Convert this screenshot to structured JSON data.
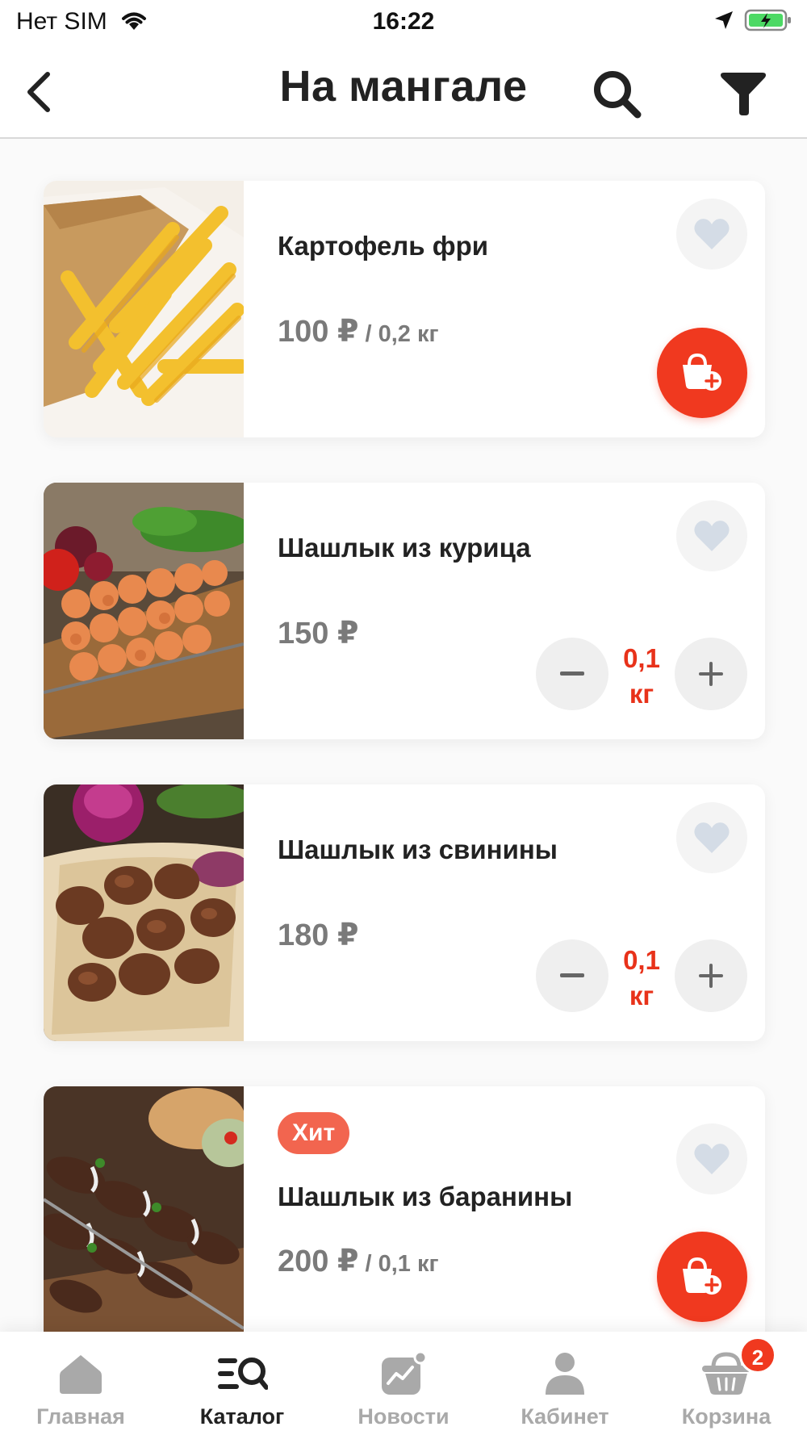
{
  "status_bar": {
    "carrier": "Нет SIM",
    "time": "16:22",
    "icons": [
      "wifi-icon",
      "location-arrow-icon",
      "battery-charging-icon"
    ]
  },
  "nav": {
    "title": "На мангале",
    "back_icon": "chevron-left-icon",
    "search_icon": "search-icon",
    "filter_icon": "filter-funnel-icon"
  },
  "products": [
    {
      "name": "Картофель фри",
      "price": "100 ₽",
      "price_unit": " / 0,2 кг",
      "badge": "",
      "in_cart": false,
      "image": "french-fries-photo",
      "favorite": false
    },
    {
      "name": "Шашлык из курица",
      "price": "150 ₽",
      "price_unit": "",
      "badge": "",
      "in_cart": true,
      "quantity": "0,1",
      "quantity_unit": "кг",
      "image": "chicken-shashlik-photo",
      "favorite": false
    },
    {
      "name": "Шашлык из свинины",
      "price": "180 ₽",
      "price_unit": "",
      "badge": "",
      "in_cart": true,
      "quantity": "0,1",
      "quantity_unit": "кг",
      "image": "pork-shashlik-photo",
      "favorite": false
    },
    {
      "name": "Шашлык из баранины",
      "price": "200 ₽",
      "price_unit": " / 0,1 кг",
      "badge": "Хит",
      "in_cart": false,
      "image": "lamb-shashlik-photo",
      "favorite": false
    }
  ],
  "tabs": [
    {
      "label": "Главная",
      "icon": "home-icon",
      "active": false
    },
    {
      "label": "Каталог",
      "icon": "catalog-search-icon",
      "active": true
    },
    {
      "label": "Новости",
      "icon": "news-chart-icon",
      "active": false
    },
    {
      "label": "Кабинет",
      "icon": "user-icon",
      "active": false
    },
    {
      "label": "Корзина",
      "icon": "basket-icon",
      "active": false,
      "badge": "2"
    }
  ],
  "colors": {
    "accent": "#f0391f",
    "quantity_text": "#e8321a",
    "badge_hit": "#f2654f",
    "price_text": "#7a7a7a",
    "inactive_tab": "#a9a9a9"
  }
}
